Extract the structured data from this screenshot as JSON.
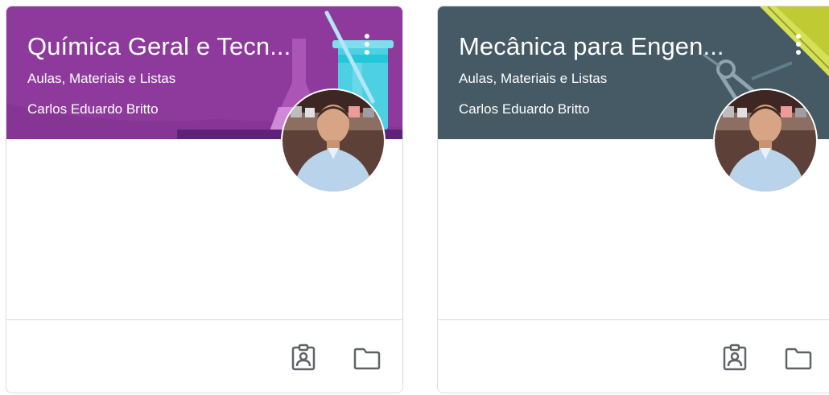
{
  "courses": [
    {
      "title": "Química Geral e Tecn...",
      "subtitle": "Aulas, Materiais e Listas",
      "teacher": "Carlos Eduardo Britto",
      "banner_color": "#8e3a9d",
      "banner_icon": "science-flask-illustration"
    },
    {
      "title": "Mecânica para Engen...",
      "subtitle": "Aulas, Materiais e Listas",
      "teacher": "Carlos Eduardo Britto",
      "banner_color": "#455a64",
      "banner_icon": "engineering-compass-illustration"
    }
  ],
  "icons": {
    "more": "more-vert-icon",
    "work": "assignment-ind-icon",
    "folder": "folder-icon"
  }
}
